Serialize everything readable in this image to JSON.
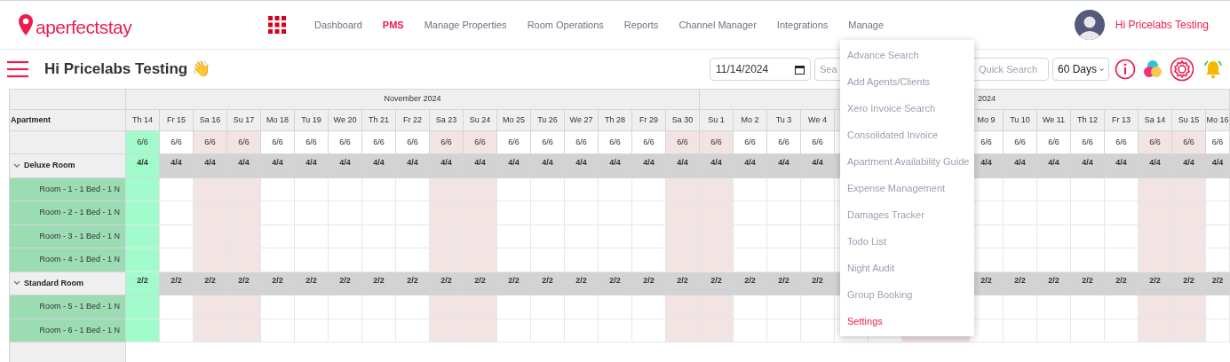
{
  "brand": {
    "logo": "a**perfect**stay"
  },
  "nav": [
    {
      "label": "Dashboard",
      "selected": false
    },
    {
      "label": "PMS",
      "selected": true
    },
    {
      "label": "Manage Properties",
      "selected": false
    },
    {
      "label": "Room Operations",
      "selected": false
    },
    {
      "label": "Reports",
      "selected": false
    },
    {
      "label": "Channel Manager",
      "selected": false
    },
    {
      "label": "Integrations",
      "selected": false
    },
    {
      "label": "Manage",
      "selected": false
    }
  ],
  "user": {
    "greeting": "Hi Pricelabs Testing"
  },
  "page_title": "Hi Pricelabs Testing 👋",
  "toolbar": {
    "date": "11/14/2024",
    "search": {
      "placeholder": "Sea"
    },
    "quick_search": {
      "placeholder": "Quick Search"
    },
    "range": "60 Days"
  },
  "manage_menu": [
    {
      "label": "Advance Search",
      "selected": false
    },
    {
      "label": "Add Agents/Clients",
      "selected": false
    },
    {
      "label": "Xero Invoice Search",
      "selected": false
    },
    {
      "label": "Consolidated Invoice",
      "selected": false
    },
    {
      "label": "Apartment Availability Guide",
      "selected": false
    },
    {
      "label": "Expense Management",
      "selected": false
    },
    {
      "label": "Damages Tracker",
      "selected": false
    },
    {
      "label": "Todo List",
      "selected": false
    },
    {
      "label": "Night Audit",
      "selected": false
    },
    {
      "label": "Group Booking",
      "selected": false
    },
    {
      "label": "Settings",
      "selected": true
    }
  ],
  "calendar": {
    "corner_label": "Apartment",
    "months": [
      {
        "label": "November 2024",
        "days": [
          {
            "label": "Th 14",
            "today": true,
            "weekend": false,
            "available": "6/6",
            "group_counts": [
              "4/4",
              "2/2"
            ]
          },
          {
            "label": "Fr 15",
            "today": false,
            "weekend": false,
            "available": "6/6",
            "group_counts": [
              "4/4",
              "2/2"
            ]
          },
          {
            "label": "Sa 16",
            "today": false,
            "weekend": true,
            "available": "6/6",
            "group_counts": [
              "4/4",
              "2/2"
            ]
          },
          {
            "label": "Su 17",
            "today": false,
            "weekend": true,
            "available": "6/6",
            "group_counts": [
              "4/4",
              "2/2"
            ]
          },
          {
            "label": "Mo 18",
            "today": false,
            "weekend": false,
            "available": "6/6",
            "group_counts": [
              "4/4",
              "2/2"
            ]
          },
          {
            "label": "Tu 19",
            "today": false,
            "weekend": false,
            "available": "6/6",
            "group_counts": [
              "4/4",
              "2/2"
            ]
          },
          {
            "label": "We 20",
            "today": false,
            "weekend": false,
            "available": "6/6",
            "group_counts": [
              "4/4",
              "2/2"
            ]
          },
          {
            "label": "Th 21",
            "today": false,
            "weekend": false,
            "available": "6/6",
            "group_counts": [
              "4/4",
              "2/2"
            ]
          },
          {
            "label": "Fr 22",
            "today": false,
            "weekend": false,
            "available": "6/6",
            "group_counts": [
              "4/4",
              "2/2"
            ]
          },
          {
            "label": "Sa 23",
            "today": false,
            "weekend": true,
            "available": "6/6",
            "group_counts": [
              "4/4",
              "2/2"
            ]
          },
          {
            "label": "Su 24",
            "today": false,
            "weekend": true,
            "available": "6/6",
            "group_counts": [
              "4/4",
              "2/2"
            ]
          },
          {
            "label": "Mo 25",
            "today": false,
            "weekend": false,
            "available": "6/6",
            "group_counts": [
              "4/4",
              "2/2"
            ]
          },
          {
            "label": "Tu 26",
            "today": false,
            "weekend": false,
            "available": "6/6",
            "group_counts": [
              "4/4",
              "2/2"
            ]
          },
          {
            "label": "We 27",
            "today": false,
            "weekend": false,
            "available": "6/6",
            "group_counts": [
              "4/4",
              "2/2"
            ]
          },
          {
            "label": "Th 28",
            "today": false,
            "weekend": false,
            "available": "6/6",
            "group_counts": [
              "4/4",
              "2/2"
            ]
          },
          {
            "label": "Fr 29",
            "today": false,
            "weekend": false,
            "available": "6/6",
            "group_counts": [
              "4/4",
              "2/2"
            ]
          },
          {
            "label": "Sa 30",
            "today": false,
            "weekend": true,
            "available": "6/6",
            "group_counts": [
              "4/4",
              "2/2"
            ]
          }
        ]
      },
      {
        "label": "2024",
        "days": [
          {
            "label": "Su 1",
            "today": false,
            "weekend": true,
            "available": "6/6",
            "group_counts": [
              "4/4",
              "2/2"
            ]
          },
          {
            "label": "Mo 2",
            "today": false,
            "weekend": false,
            "available": "6/6",
            "group_counts": [
              "4/4",
              "2/2"
            ]
          },
          {
            "label": "Tu 3",
            "today": false,
            "weekend": false,
            "available": "6/6",
            "group_counts": [
              "4/4",
              "2/2"
            ]
          },
          {
            "label": "We 4",
            "today": false,
            "weekend": false,
            "available": "6/6",
            "group_counts": [
              "4/4",
              "2/2"
            ]
          },
          {
            "today": false,
            "weekend": false
          },
          {
            "today": false,
            "weekend": false
          },
          {
            "today": false,
            "weekend": true
          },
          {
            "today": false,
            "weekend": true
          },
          {
            "label": "Mo 9",
            "today": false,
            "weekend": false,
            "available": "6/6",
            "group_counts": [
              "4/4",
              "2/2"
            ]
          },
          {
            "label": "Tu 10",
            "today": false,
            "weekend": false,
            "available": "6/6",
            "group_counts": [
              "4/4",
              "2/2"
            ]
          },
          {
            "label": "We 11",
            "today": false,
            "weekend": false,
            "available": "6/6",
            "group_counts": [
              "4/4",
              "2/2"
            ]
          },
          {
            "label": "Th 12",
            "today": false,
            "weekend": false,
            "available": "6/6",
            "group_counts": [
              "4/4",
              "2/2"
            ]
          },
          {
            "label": "Fr 13",
            "today": false,
            "weekend": false,
            "available": "6/6",
            "group_counts": [
              "4/4",
              "2/2"
            ]
          },
          {
            "label": "Sa 14",
            "today": false,
            "weekend": true,
            "available": "6/6",
            "group_counts": [
              "4/4",
              "2/2"
            ]
          },
          {
            "label": "Su 15",
            "today": false,
            "weekend": true,
            "available": "6/6",
            "group_counts": [
              "4/4",
              "2/2"
            ]
          },
          {
            "label": "Mo 16",
            "today": false,
            "weekend": false,
            "available": "6/6",
            "group_counts": [
              "4/4",
              "2/2"
            ]
          }
        ]
      }
    ],
    "groups": [
      {
        "name": "Deluxe Room",
        "expanded": true,
        "rooms": [
          "Room - 1 - 1 Bed - 1 N",
          "Room - 2 - 1 Bed - 1 N",
          "Room - 3 - 1 Bed - 1 N",
          "Room - 4 - 1 Bed - 1 N"
        ]
      },
      {
        "name": "Standard Room",
        "expanded": true,
        "rooms": [
          "Room - 5 - 1 Bed - 1 N",
          "Room - 6 - 1 Bed - 1 N"
        ]
      }
    ]
  }
}
